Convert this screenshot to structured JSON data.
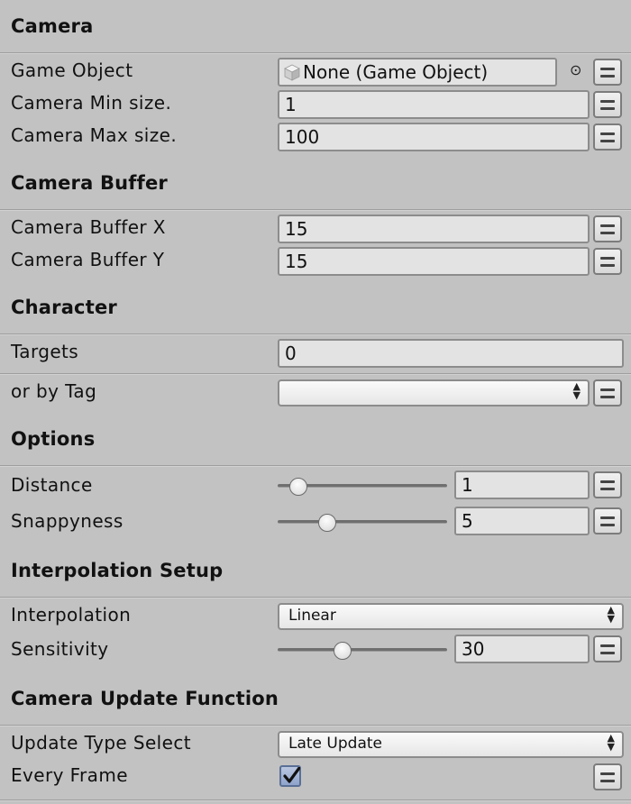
{
  "sections": {
    "camera": {
      "header": "Camera",
      "game_object": {
        "label": "Game Object",
        "value": "None (Game Object)"
      },
      "min_size": {
        "label": "Camera Min size.",
        "value": "1"
      },
      "max_size": {
        "label": "Camera Max size.",
        "value": "100"
      }
    },
    "camera_buffer": {
      "header": "Camera Buffer",
      "buffer_x": {
        "label": "Camera Buffer X",
        "value": "15"
      },
      "buffer_y": {
        "label": "Camera Buffer Y",
        "value": "15"
      }
    },
    "character": {
      "header": "Character",
      "targets": {
        "label": "Targets",
        "value": "0"
      },
      "by_tag": {
        "label": "or by Tag",
        "value": ""
      }
    },
    "options": {
      "header": "Options",
      "distance": {
        "label": "Distance",
        "value": "1",
        "slider_fraction": 0.08
      },
      "snappyness": {
        "label": "Snappyness",
        "value": "5",
        "slider_fraction": 0.27
      }
    },
    "interpolation": {
      "header": "Interpolation Setup",
      "interpolation": {
        "label": "Interpolation",
        "value": "Linear"
      },
      "sensitivity": {
        "label": "Sensitivity",
        "value": "30",
        "slider_fraction": 0.37
      }
    },
    "update": {
      "header": "Camera Update Function",
      "type_select": {
        "label": "Update Type Select",
        "value": "Late Update"
      },
      "every_frame": {
        "label": "Every Frame",
        "checked": true
      }
    }
  },
  "icons": {
    "object_picker": "⊙",
    "dropdown_arrows": "▲▼",
    "checkmark": "✔"
  },
  "colors": {
    "background": "#c2c2c2",
    "field_bg": "#e3e3e3",
    "checkbox": "#8fa3cb"
  }
}
